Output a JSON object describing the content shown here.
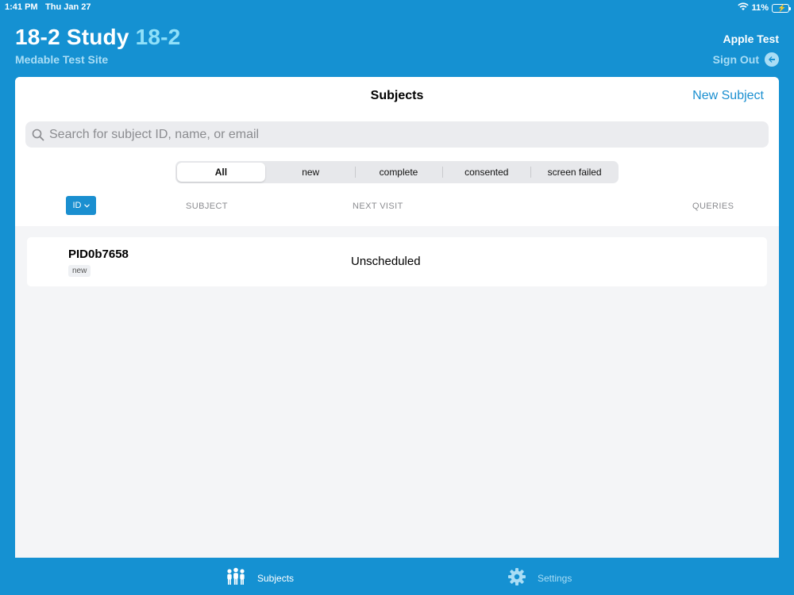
{
  "status_bar": {
    "time": "1:41 PM",
    "date": "Thu Jan 27",
    "battery": "11%"
  },
  "header": {
    "study_name": "18-2 Study",
    "study_code": "18-2",
    "site_name": "Medable Test Site",
    "user_name": "Apple Test",
    "sign_out_label": "Sign Out"
  },
  "subjects_panel": {
    "title": "Subjects",
    "new_subject_label": "New Subject",
    "search_placeholder": "Search for subject ID, name, or email",
    "filters": [
      "All",
      "new",
      "complete",
      "consented",
      "screen failed"
    ],
    "active_filter": "All",
    "sort_label": "ID",
    "columns": {
      "subject": "SUBJECT",
      "next_visit": "NEXT VISIT",
      "queries": "QUERIES"
    },
    "rows": [
      {
        "id": "PID0b7658",
        "status": "new",
        "next_visit": "Unscheduled",
        "queries": ""
      }
    ]
  },
  "tab_bar": {
    "tabs": [
      {
        "label": "Subjects",
        "icon": "people-icon",
        "active": true
      },
      {
        "label": "Settings",
        "icon": "gear-icon",
        "active": false
      }
    ]
  },
  "colors": {
    "primary": "#1591d2",
    "accent": "#1a8fd0",
    "code_highlight": "#8fe0f9"
  }
}
